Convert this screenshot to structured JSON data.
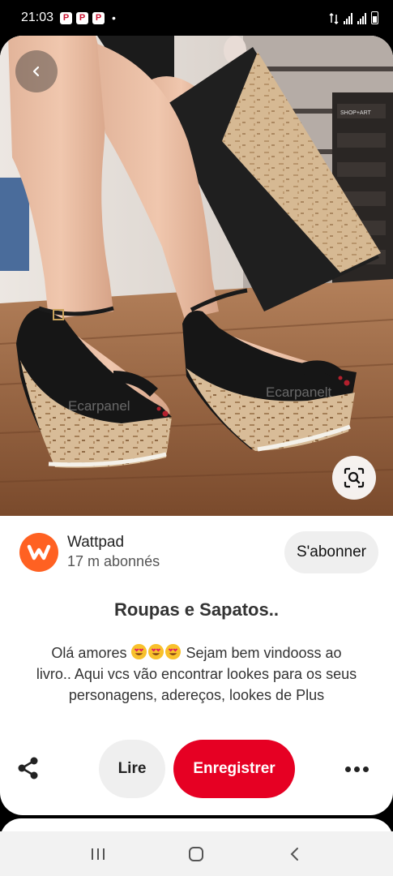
{
  "status_bar": {
    "time": "21:03",
    "notification_badges": [
      "P",
      "P",
      "P"
    ],
    "dot": "•",
    "icons": [
      "data-arrows-icon",
      "signal-icon",
      "signal-icon",
      "battery-icon"
    ]
  },
  "pin": {
    "image_alt": "wedge-sandals-photo",
    "watermarks": [
      "Ecarpanel",
      "Ecarpanelt"
    ],
    "shelf_box_label": "SHOP+ART"
  },
  "creator": {
    "avatar_letter": "w",
    "name": "Wattpad",
    "followers": "17 m abonnés",
    "follow_label": "S'abonner"
  },
  "title": "Roupas e Sapatos..",
  "description": {
    "part1": "Olá amores ",
    "emojis": [
      "heart-eyes-emoji",
      "heart-eyes-emoji",
      "heart-eyes-emoji"
    ],
    "part2": " Sejam bem vindooss ao livro.. Aqui vcs vão encontrar lookes para os seus personagens, adereços, lookes de Plus"
  },
  "actions": {
    "read_label": "Lire",
    "save_label": "Enregistrer"
  },
  "colors": {
    "save_button": "#e60023",
    "wattpad_orange": "#ff6122",
    "secondary_button": "#efefef"
  }
}
